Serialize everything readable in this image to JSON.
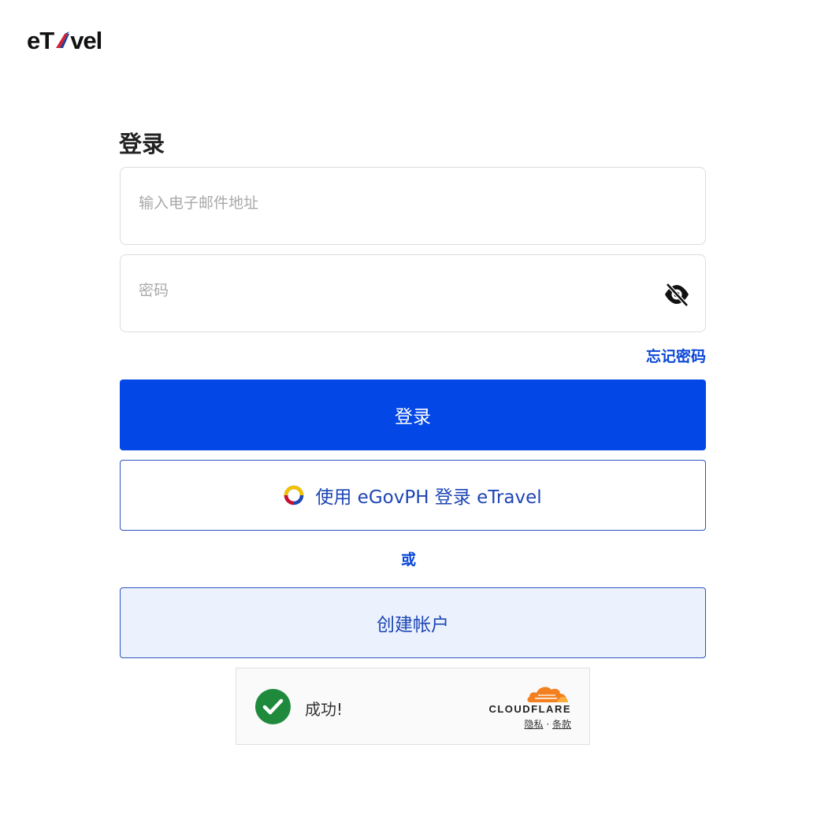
{
  "header": {
    "logo_text_left": "eT",
    "logo_text_right": "vel",
    "logo_alt": "eTravel"
  },
  "login": {
    "title": "登录",
    "email_placeholder": "输入电子邮件地址",
    "password_placeholder": "密码",
    "forgot_password": "忘记密码",
    "submit_label": "登录",
    "egov_label": "使用 eGovPH 登录 eTravel",
    "or_label": "或",
    "create_account_label": "创建帐户"
  },
  "captcha": {
    "status": "成功!",
    "brand": "CLOUDFLARE",
    "privacy": "隐私",
    "separator": "·",
    "terms": "条款"
  },
  "colors": {
    "primary": "#0347e7",
    "link": "#0a47d6",
    "secondary_bg": "#ebf2fd",
    "success": "#1f8a3c",
    "cloudflare_orange": "#f38020"
  },
  "icons": {
    "password_toggle": "eye-off-icon",
    "egov": "egov-ring-icon",
    "captcha_status": "check-circle-icon",
    "captcha_brand": "cloudflare-cloud-icon"
  }
}
